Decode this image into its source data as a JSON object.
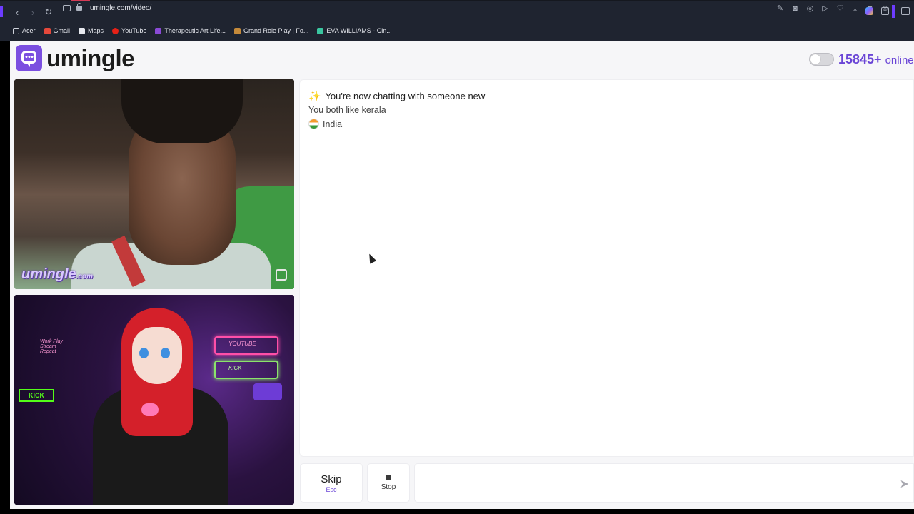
{
  "browser": {
    "url": "umingle.com/video/",
    "bookmarks": [
      {
        "label": "Acer",
        "icon": "folder-icon"
      },
      {
        "label": "Gmail",
        "icon": "gmail-icon"
      },
      {
        "label": "Maps",
        "icon": "maps-icon"
      },
      {
        "label": "YouTube",
        "icon": "youtube-icon"
      },
      {
        "label": "Therapeutic Art Life...",
        "icon": "app-icon"
      },
      {
        "label": "Grand Role Play | Fo...",
        "icon": "game-icon"
      },
      {
        "label": "EVA WILLIAMS - Cin...",
        "icon": "site-icon"
      }
    ]
  },
  "header": {
    "logo_text": "umingle",
    "online_count": "15845+",
    "online_word": "online"
  },
  "video": {
    "watermark": "umingle",
    "watermark_suffix": ".com",
    "overlay_youtube": "YOUTUBE",
    "overlay_kick": "KICK",
    "overlay_kick_badge": "KICK",
    "overlay_left": "Work Play Stream Repeat"
  },
  "chat": {
    "status": "You're now chatting with someone new",
    "interest": "You both like kerala",
    "country": "India"
  },
  "controls": {
    "skip_label": "Skip",
    "skip_hint": "Esc",
    "stop_label": "Stop"
  },
  "colors": {
    "accent": "#6a45d6",
    "logo": "#7b4fe0"
  }
}
